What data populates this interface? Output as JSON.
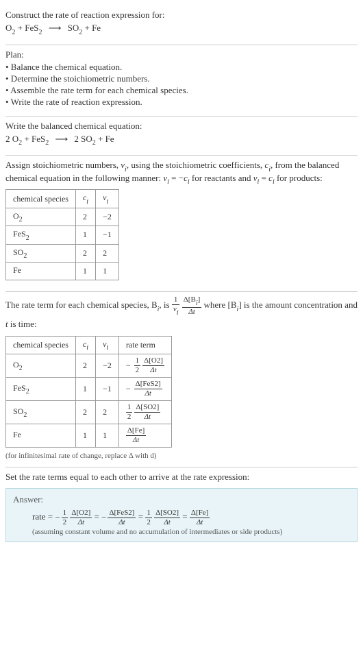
{
  "prompt": {
    "title": "Construct the rate of reaction expression for:",
    "equation_lhs1": "O",
    "equation_lhs1_sub": "2",
    "plus1": " + ",
    "equation_lhs2": "FeS",
    "equation_lhs2_sub": "2",
    "arrow": "⟶",
    "equation_rhs1": "SO",
    "equation_rhs1_sub": "2",
    "plus2": " + ",
    "equation_rhs2": "Fe"
  },
  "plan": {
    "title": "Plan:",
    "items": [
      "• Balance the chemical equation.",
      "• Determine the stoichiometric numbers.",
      "• Assemble the rate term for each chemical species.",
      "• Write the rate of reaction expression."
    ]
  },
  "balanced": {
    "title": "Write the balanced chemical equation:",
    "c1": "2 ",
    "s1": "O",
    "s1sub": "2",
    "plus1": " + ",
    "s2": "FeS",
    "s2sub": "2",
    "arrow": "⟶",
    "c3": " 2 ",
    "s3": "SO",
    "s3sub": "2",
    "plus2": " + ",
    "s4": "Fe"
  },
  "stoich": {
    "intro1": "Assign stoichiometric numbers, ",
    "nu": "ν",
    "isub": "i",
    "intro2": ", using the stoichiometric coefficients, ",
    "c": "c",
    "intro3": ", from the balanced chemical equation in the following manner: ",
    "rel1a": "ν",
    "rel1b": " = −",
    "rel1c": "c",
    "rel1d": " for reactants and ",
    "rel2a": "ν",
    "rel2b": " = ",
    "rel2c": "c",
    "rel2d": " for products:",
    "headers": {
      "species": "chemical species",
      "ci": "c",
      "ci_sub": "i",
      "vi": "ν",
      "vi_sub": "i"
    },
    "rows": [
      {
        "species_a": "O",
        "species_sub": "2",
        "ci": "2",
        "vi": "−2"
      },
      {
        "species_a": "FeS",
        "species_sub": "2",
        "ci": "1",
        "vi": "−1"
      },
      {
        "species_a": "SO",
        "species_sub": "2",
        "ci": "2",
        "vi": "2"
      },
      {
        "species_a": "Fe",
        "species_sub": "",
        "ci": "1",
        "vi": "1"
      }
    ]
  },
  "rateterm": {
    "intro1": "The rate term for each chemical species, B",
    "isub": "i",
    "intro2": ", is ",
    "frac1_num": "1",
    "frac1_den_a": "ν",
    "frac1_den_sub": "i",
    "frac2_num": "Δ[B",
    "frac2_num_sub": "i",
    "frac2_num_end": "]",
    "frac2_den": "Δt",
    "intro3": " where [B",
    "intro4": "] is the amount concentration and ",
    "tvar": "t",
    "intro5": " is time:",
    "headers": {
      "species": "chemical species",
      "ci": "c",
      "ci_sub": "i",
      "vi": "ν",
      "vi_sub": "i",
      "rate": "rate term"
    },
    "rows": [
      {
        "species_a": "O",
        "species_sub": "2",
        "ci": "2",
        "vi": "−2",
        "neg": "−",
        "coef_num": "1",
        "coef_den": "2",
        "d_num": "Δ[O2]",
        "d_den": "Δt"
      },
      {
        "species_a": "FeS",
        "species_sub": "2",
        "ci": "1",
        "vi": "−1",
        "neg": "−",
        "coef_num": "",
        "coef_den": "",
        "d_num": "Δ[FeS2]",
        "d_den": "Δt"
      },
      {
        "species_a": "SO",
        "species_sub": "2",
        "ci": "2",
        "vi": "2",
        "neg": "",
        "coef_num": "1",
        "coef_den": "2",
        "d_num": "Δ[SO2]",
        "d_den": "Δt"
      },
      {
        "species_a": "Fe",
        "species_sub": "",
        "ci": "1",
        "vi": "1",
        "neg": "",
        "coef_num": "",
        "coef_den": "",
        "d_num": "Δ[Fe]",
        "d_den": "Δt"
      }
    ],
    "footnote": "(for infinitesimal rate of change, replace Δ with d)"
  },
  "final": {
    "title": "Set the rate terms equal to each other to arrive at the rate expression:"
  },
  "answer": {
    "label": "Answer:",
    "rate_label": "rate = ",
    "terms": [
      {
        "neg": "−",
        "coef_num": "1",
        "coef_den": "2",
        "d_num": "Δ[O2]",
        "d_den": "Δt"
      },
      {
        "neg": "−",
        "coef_num": "",
        "coef_den": "",
        "d_num": "Δ[FeS2]",
        "d_den": "Δt"
      },
      {
        "neg": "",
        "coef_num": "1",
        "coef_den": "2",
        "d_num": "Δ[SO2]",
        "d_den": "Δt"
      },
      {
        "neg": "",
        "coef_num": "",
        "coef_den": "",
        "d_num": "Δ[Fe]",
        "d_den": "Δt"
      }
    ],
    "eq": " = ",
    "note": "(assuming constant volume and no accumulation of intermediates or side products)"
  }
}
